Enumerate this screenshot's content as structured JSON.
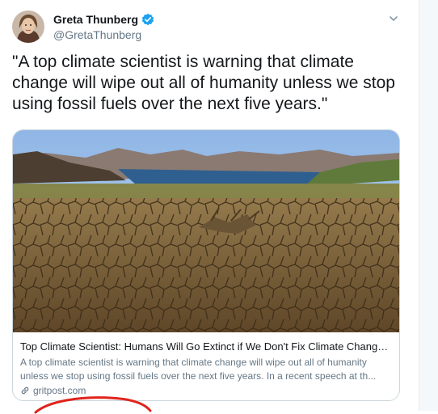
{
  "tweet": {
    "display_name": "Greta Thunberg",
    "handle": "@GretaThunberg",
    "text": "\"A top climate scientist is warning that climate change will wipe out all of humanity unless we stop using fossil fuels over the next five years.\""
  },
  "link_card": {
    "title": "Top Climate Scientist: Humans Will Go Extinct if We Don't Fix Climate Change by ...",
    "description": "A top climate scientist is warning that climate change will wipe out all of humanity unless we stop using fossil fuels over the next five years. In a recent speech at th...",
    "domain": "gritpost.com"
  },
  "colors": {
    "verified": "#1da1f2",
    "annotation": "#e0241b"
  },
  "icons": [
    "verified-badge-icon",
    "chevron-down-icon",
    "link-icon"
  ]
}
